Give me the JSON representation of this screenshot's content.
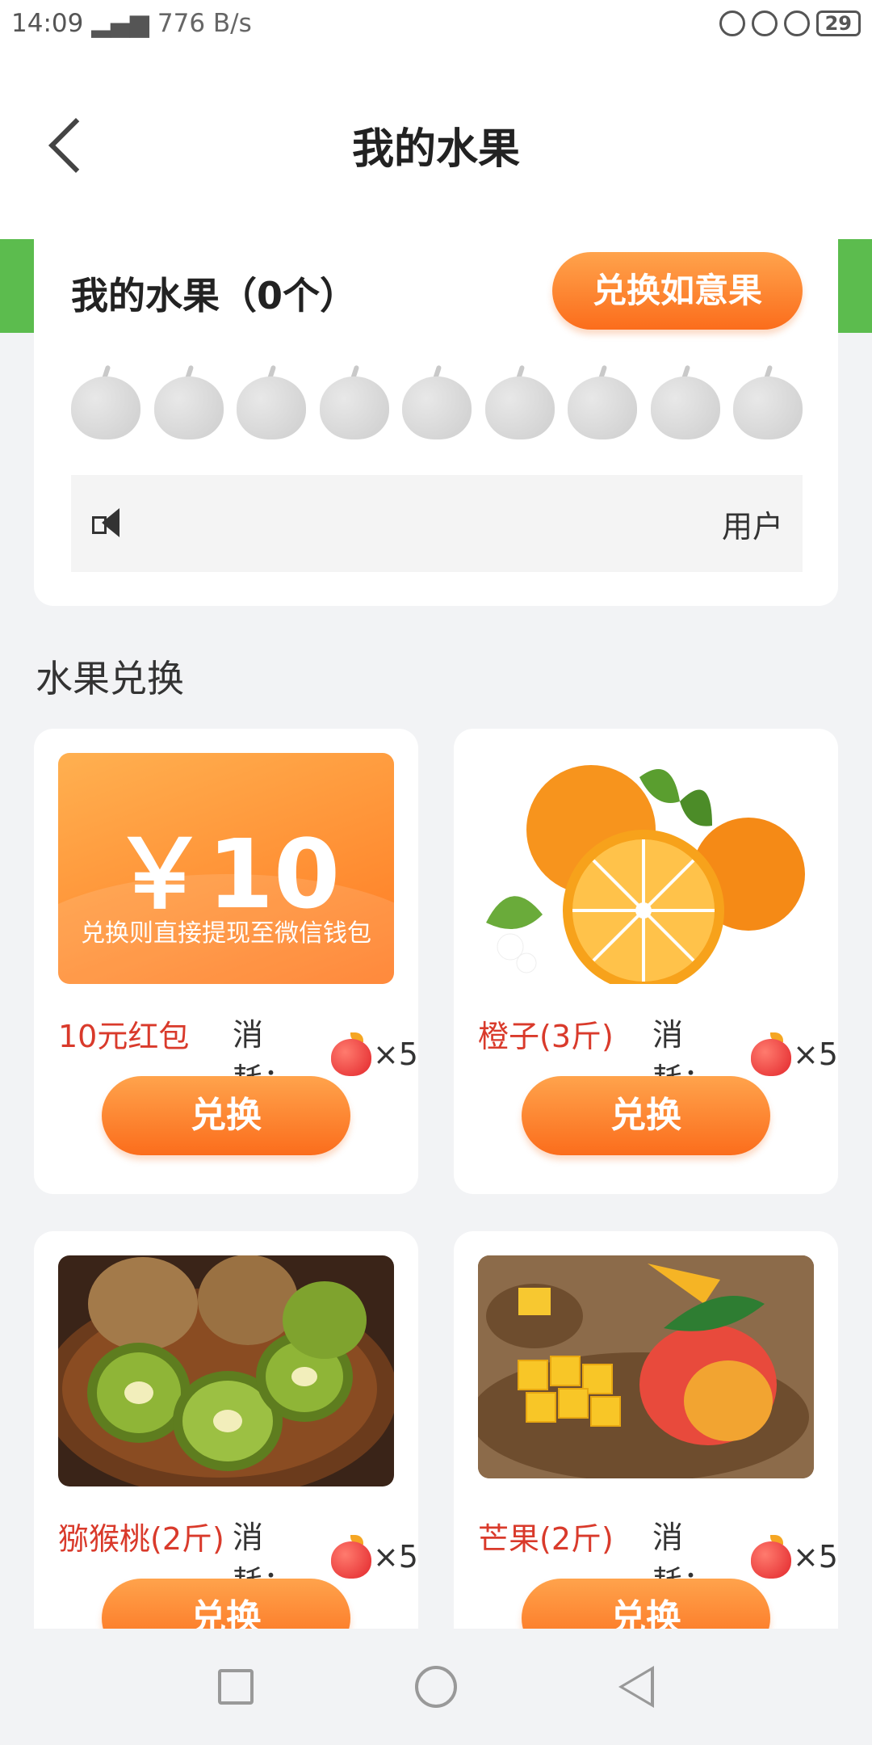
{
  "status_bar": {
    "time": "14:09",
    "network": "776 B/s",
    "battery": "29"
  },
  "header": {
    "title": "我的水果"
  },
  "my_fruit": {
    "title": "我的水果（0个）",
    "exchange_button": "兑换如意果",
    "apple_count_shown": 9,
    "notice_text": "用户"
  },
  "section": {
    "title": "水果兑换"
  },
  "products": [
    {
      "name": "10元红包",
      "cost_label": "消耗：",
      "cost_qty": "×5",
      "button": "兑换",
      "amount": "￥10",
      "desc": "兑换则直接提现至微信钱包"
    },
    {
      "name": "橙子(3斤)",
      "cost_label": "消耗：",
      "cost_qty": "×5",
      "button": "兑换"
    },
    {
      "name": "猕猴桃(2斤)",
      "cost_label": "消耗：",
      "cost_qty": "×5",
      "button": "兑换"
    },
    {
      "name": "芒果(2斤)",
      "cost_label": "消耗：",
      "cost_qty": "×5",
      "button": "兑换"
    }
  ]
}
